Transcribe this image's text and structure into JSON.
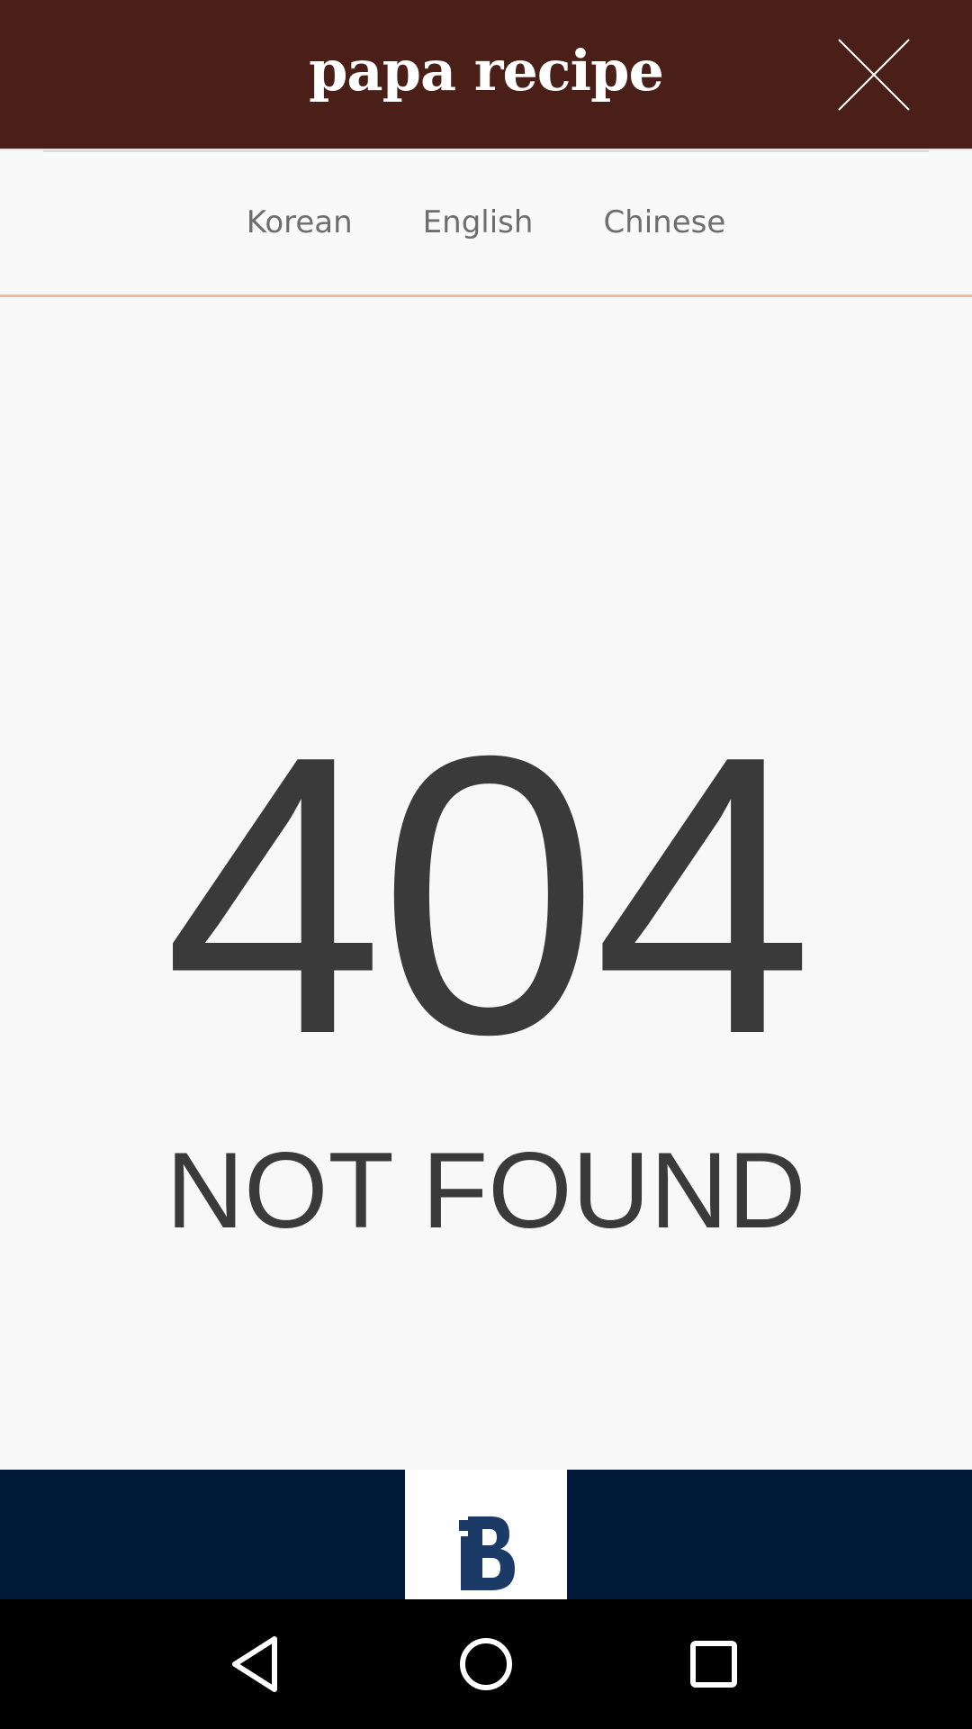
{
  "header": {
    "logo_text": "papa recipe",
    "close_icon": "close-icon"
  },
  "languages": [
    {
      "label": "Korean"
    },
    {
      "label": "English"
    },
    {
      "label": "Chinese"
    }
  ],
  "error": {
    "code": "404",
    "message": "NOT FOUND"
  },
  "banner": {
    "logo_icon": "brand-b-logo"
  },
  "system_nav": {
    "back_icon": "back-icon",
    "home_icon": "home-icon",
    "recents_icon": "recents-icon"
  },
  "colors": {
    "header_bg": "#4a1f17",
    "accent_line": "#f0b8a0",
    "text_dark": "#3a3a3a",
    "banner_bg": "#031b3a"
  }
}
